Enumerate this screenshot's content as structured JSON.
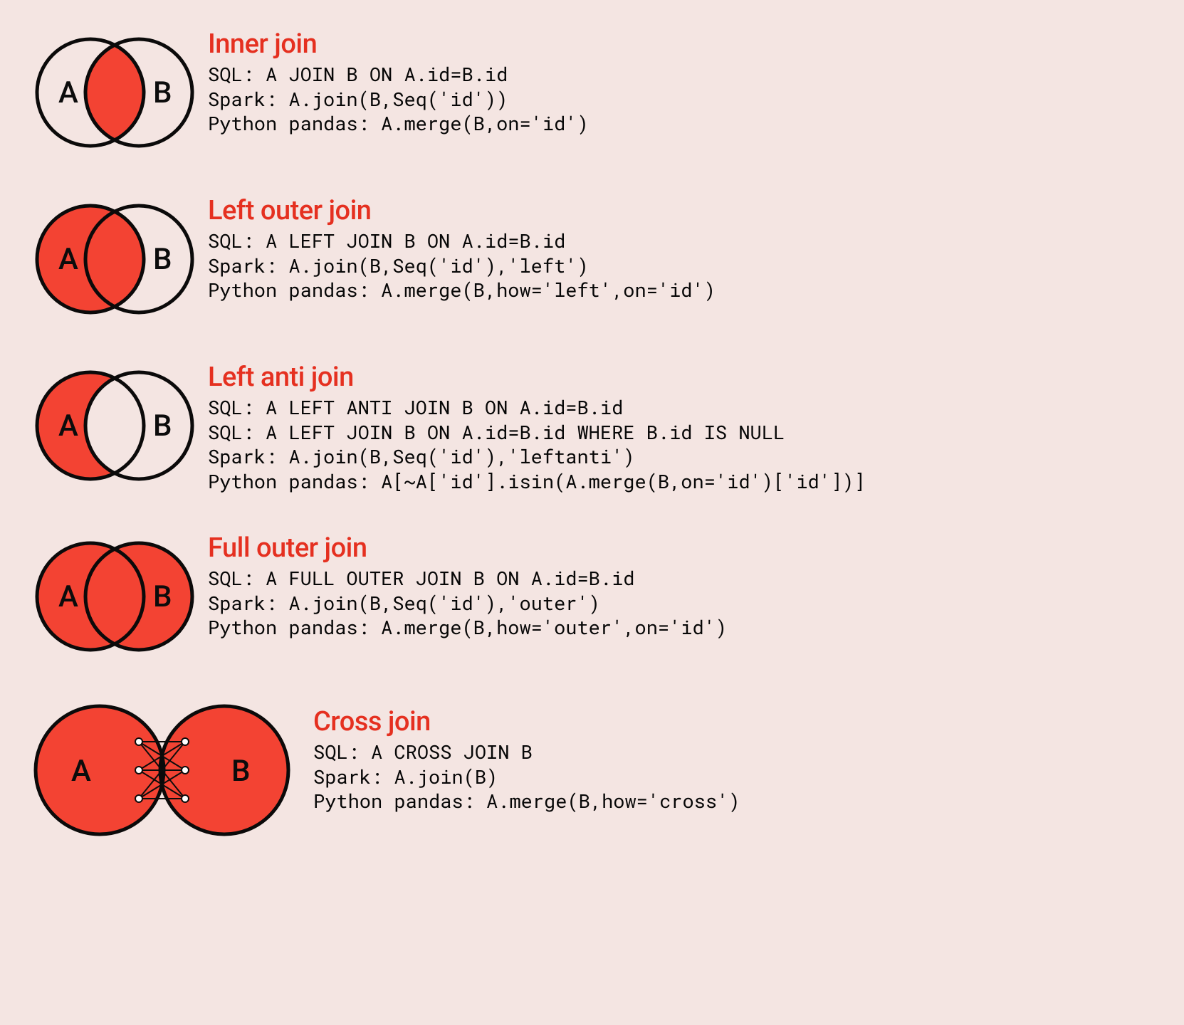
{
  "labelA": "A",
  "labelB": "B",
  "joins": [
    {
      "title": "Inner join",
      "venn": "inner",
      "lines": [
        "SQL: A JOIN B ON A.id=B.id",
        "Spark: A.join(B,Seq('id'))",
        "Python pandas: A.merge(B,on='id')"
      ]
    },
    {
      "title": "Left outer join",
      "venn": "left",
      "lines": [
        "SQL: A LEFT JOIN B ON A.id=B.id",
        "Spark: A.join(B,Seq('id'),'left')",
        "Python pandas: A.merge(B,how='left',on='id')"
      ]
    },
    {
      "title": "Left anti join",
      "venn": "leftanti",
      "lines": [
        "SQL: A LEFT ANTI JOIN B ON A.id=B.id",
        "SQL: A LEFT JOIN B ON A.id=B.id WHERE B.id IS NULL",
        "Spark: A.join(B,Seq('id'),'leftanti')",
        "Python pandas: A[~A['id'].isin(A.merge(B,on='id')['id'])]"
      ]
    },
    {
      "title": "Full outer join",
      "venn": "outer",
      "lines": [
        "SQL: A FULL OUTER JOIN B ON A.id=B.id",
        "Spark: A.join(B,Seq('id'),'outer')",
        "Python pandas: A.merge(B,how='outer',on='id')"
      ]
    },
    {
      "title": "Cross join",
      "venn": "cross",
      "lines": [
        "SQL: A CROSS JOIN B",
        "Spark: A.join(B)",
        "Python pandas: A.merge(B,how='cross')"
      ]
    }
  ]
}
